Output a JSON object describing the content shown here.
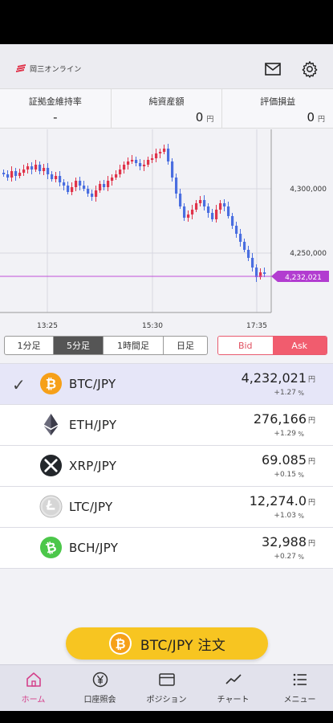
{
  "header": {
    "brand": "岡三オンライン"
  },
  "stats": [
    {
      "label": "証拠金維持率",
      "value": "-",
      "unit": ""
    },
    {
      "label": "純資産額",
      "value": "0",
      "unit": "円"
    },
    {
      "label": "評価損益",
      "value": "0",
      "unit": "円"
    }
  ],
  "chart": {
    "y_ticks": [
      "4,300,000",
      "4,250,000"
    ],
    "x_ticks": [
      "13:25",
      "15:30",
      "17:35"
    ],
    "current_price": "4,232,021"
  },
  "chart_data": {
    "type": "candlestick",
    "y_ticks": [
      4300000,
      4250000
    ],
    "x_ticks": [
      "13:25",
      "15:30",
      "17:35"
    ],
    "current": 4232021,
    "colors": {
      "up": "#e0334a",
      "down": "#4a6ee0",
      "price_line": "#c050d8"
    }
  },
  "timeframes": [
    "1分足",
    "5分足",
    "1時間足",
    "日足"
  ],
  "active_timeframe": 1,
  "side": {
    "bid": "Bid",
    "ask": "Ask"
  },
  "pairs": [
    {
      "icon": "btc-icon",
      "name": "BTC/JPY",
      "price": "4,232,021",
      "unit": "円",
      "change": "+1.27",
      "pct": "%",
      "selected": true
    },
    {
      "icon": "eth-icon",
      "name": "ETH/JPY",
      "price": "276,166",
      "unit": "円",
      "change": "+1.29",
      "pct": "%",
      "selected": false
    },
    {
      "icon": "xrp-icon",
      "name": "XRP/JPY",
      "price": "69.085",
      "unit": "円",
      "change": "+0.15",
      "pct": "%",
      "selected": false
    },
    {
      "icon": "ltc-icon",
      "name": "LTC/JPY",
      "price": "12,274.0",
      "unit": "円",
      "change": "+1.03",
      "pct": "%",
      "selected": false
    },
    {
      "icon": "bch-icon",
      "name": "BCH/JPY",
      "price": "32,988",
      "unit": "円",
      "change": "+0.27",
      "pct": "%",
      "selected": false
    }
  ],
  "order": {
    "label": "BTC/JPY  注文"
  },
  "tabs": [
    {
      "icon": "home-icon",
      "label": "ホーム",
      "active": true
    },
    {
      "icon": "yen-icon",
      "label": "口座照会",
      "active": false
    },
    {
      "icon": "card-icon",
      "label": "ポジション",
      "active": false
    },
    {
      "icon": "chart-icon",
      "label": "チャート",
      "active": false
    },
    {
      "icon": "menu-icon",
      "label": "メニュー",
      "active": false
    }
  ]
}
